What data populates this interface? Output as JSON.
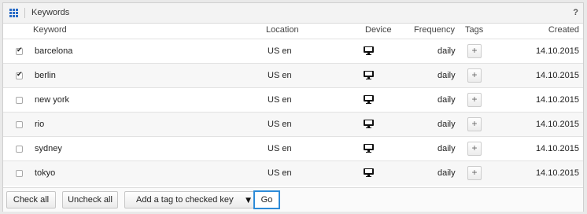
{
  "panel": {
    "title": "Keywords",
    "help": "?"
  },
  "columns": {
    "keyword": "Keyword",
    "location": "Location",
    "device": "Device",
    "frequency": "Frequency",
    "tags": "Tags",
    "created": "Created"
  },
  "rows": [
    {
      "checked": true,
      "keyword": "barcelona",
      "location": "US en",
      "device": "desktop-icon",
      "frequency": "daily",
      "tag_button": "+",
      "created": "14.10.2015"
    },
    {
      "checked": true,
      "keyword": "berlin",
      "location": "US en",
      "device": "desktop-icon",
      "frequency": "daily",
      "tag_button": "+",
      "created": "14.10.2015"
    },
    {
      "checked": false,
      "keyword": "new york",
      "location": "US en",
      "device": "desktop-icon",
      "frequency": "daily",
      "tag_button": "+",
      "created": "14.10.2015"
    },
    {
      "checked": false,
      "keyword": "rio",
      "location": "US en",
      "device": "desktop-icon",
      "frequency": "daily",
      "tag_button": "+",
      "created": "14.10.2015"
    },
    {
      "checked": false,
      "keyword": "sydney",
      "location": "US en",
      "device": "desktop-icon",
      "frequency": "daily",
      "tag_button": "+",
      "created": "14.10.2015"
    },
    {
      "checked": false,
      "keyword": "tokyo",
      "location": "US en",
      "device": "desktop-icon",
      "frequency": "daily",
      "tag_button": "+",
      "created": "14.10.2015"
    }
  ],
  "footer": {
    "check_all": "Check all",
    "uncheck_all": "Uncheck all",
    "tag_select_value": "Add a tag to checked keyw",
    "go": "Go"
  },
  "colors": {
    "accent": "#2d8bd8",
    "grid_icon": "#2a6cc7"
  }
}
